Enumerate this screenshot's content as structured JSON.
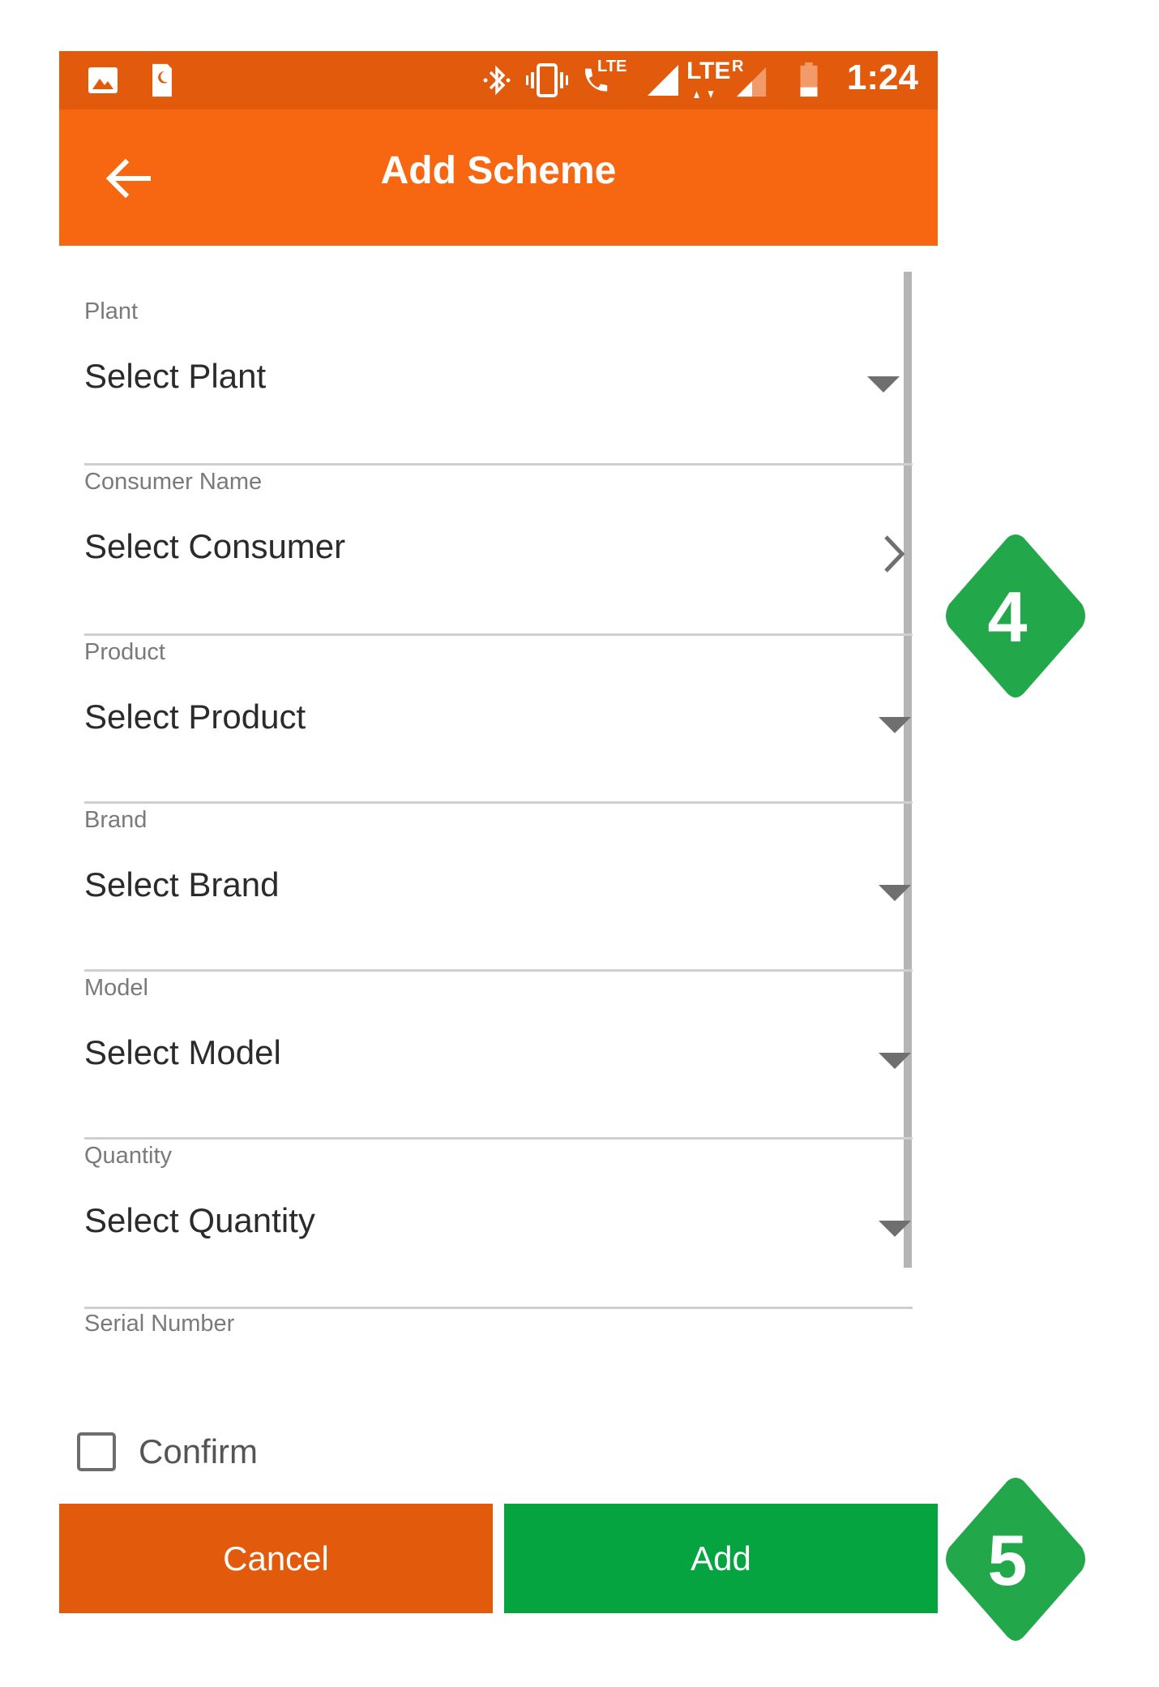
{
  "status_bar": {
    "time": "1:24",
    "color": "#e25a0c",
    "icons": [
      "image-icon",
      "sim-card-icon",
      "bluetooth-icon",
      "vibrate-icon",
      "volte-call-icon",
      "signal-icon",
      "lte-data-icon",
      "roaming-signal-icon",
      "battery-icon"
    ],
    "volte_label": "LTE",
    "lte_label": "LTE",
    "roaming_label": "R"
  },
  "app_bar": {
    "title": "Add Scheme",
    "color": "#f76711"
  },
  "form": {
    "fields": [
      {
        "label": "Plant",
        "value": "Select Plant",
        "control": "dropdown"
      },
      {
        "label": "Consumer Name",
        "value": "Select Consumer",
        "control": "chevron"
      },
      {
        "label": "Product",
        "value": "Select Product",
        "control": "dropdown"
      },
      {
        "label": "Brand",
        "value": "Select Brand",
        "control": "dropdown"
      },
      {
        "label": "Model",
        "value": "Select Model",
        "control": "dropdown"
      },
      {
        "label": "Quantity",
        "value": "Select Quantity",
        "control": "dropdown"
      },
      {
        "label": "Serial Number",
        "value": "",
        "control": "text"
      }
    ],
    "confirm": {
      "label": "Confirm",
      "checked": false
    }
  },
  "buttons": {
    "cancel": {
      "label": "Cancel",
      "color": "#e25a0c"
    },
    "add": {
      "label": "Add",
      "color": "#05a440"
    }
  },
  "callouts": [
    {
      "number": "4",
      "color": "#22a84a"
    },
    {
      "number": "5",
      "color": "#22a84a"
    }
  ]
}
